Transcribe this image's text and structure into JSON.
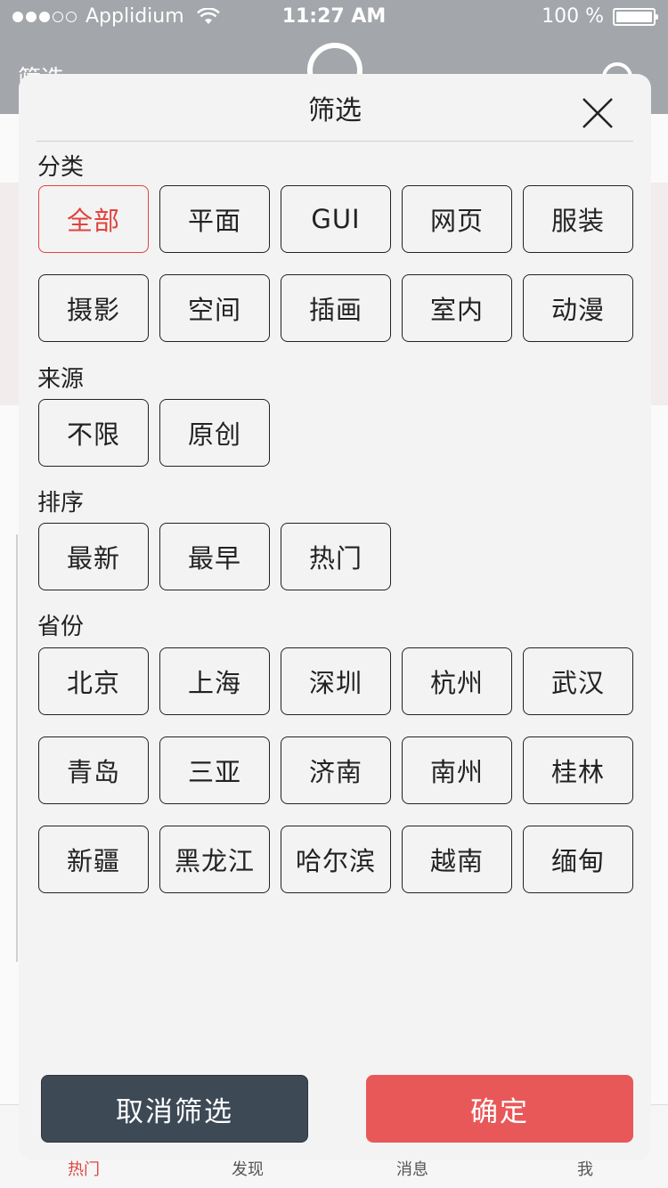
{
  "status_bar": {
    "carrier": "Applidium",
    "time": "11:27 AM",
    "battery": "100 %"
  },
  "background": {
    "nav_title": "筛选"
  },
  "tabbar": {
    "items": [
      {
        "label": "热门"
      },
      {
        "label": "发现"
      },
      {
        "label": "消息"
      },
      {
        "label": "我"
      }
    ]
  },
  "sheet": {
    "title": "筛选",
    "sections": {
      "category": {
        "label": "分类",
        "rows": [
          [
            "全部",
            "平面",
            "GUI",
            "网页",
            "服装"
          ],
          [
            "摄影",
            "空间",
            "插画",
            "室内",
            "动漫"
          ]
        ],
        "selected": "全部"
      },
      "source": {
        "label": "来源",
        "rows": [
          [
            "不限",
            "原创"
          ]
        ]
      },
      "sort": {
        "label": "排序",
        "rows": [
          [
            "最新",
            "最早",
            "热门"
          ]
        ]
      },
      "province": {
        "label": "省份",
        "rows": [
          [
            "北京",
            "上海",
            "深圳",
            "杭州",
            "武汉"
          ],
          [
            "青岛",
            "三亚",
            "济南",
            "南州",
            "桂林"
          ],
          [
            "新疆",
            "黑龙江",
            "哈尔滨",
            "越南",
            "缅甸"
          ]
        ]
      }
    },
    "cancel_label": "取消筛选",
    "confirm_label": "确定"
  },
  "colors": {
    "accent": "#e0443f",
    "confirm_bg": "#e95858",
    "cancel_bg": "#3d4a56",
    "status_bar_bg": "#a3a6aa"
  }
}
